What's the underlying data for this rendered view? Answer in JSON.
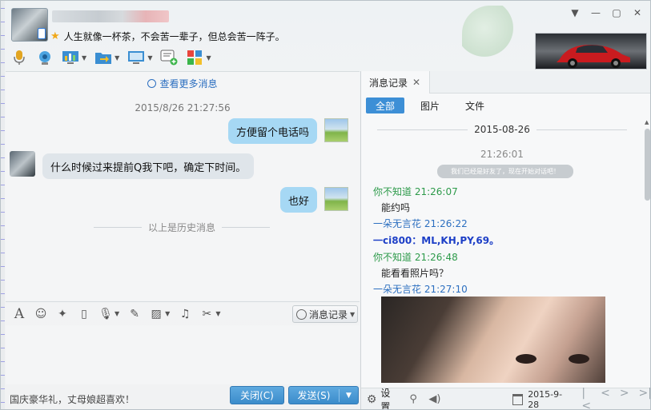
{
  "header": {
    "nickname": "█████████",
    "signature": "人生就像一杯茶，不会苦一辈子，但总会苦一阵子。",
    "window_controls": [
      "chevron-down-icon",
      "minimize-icon",
      "maximize-icon",
      "close-icon"
    ]
  },
  "toolbar": {
    "items": [
      {
        "name": "voice-call",
        "icon": "microphone-icon"
      },
      {
        "name": "video-call",
        "icon": "webcam-icon"
      },
      {
        "name": "remote-assist",
        "icon": "chart-board-icon"
      },
      {
        "name": "send-file",
        "icon": "folder-send-icon"
      },
      {
        "name": "screen-share",
        "icon": "monitor-icon"
      },
      {
        "name": "create-discussion",
        "icon": "chat-add-icon"
      },
      {
        "name": "apps",
        "icon": "apps-grid-icon"
      }
    ]
  },
  "chat": {
    "more_messages": "查看更多消息",
    "timestamp": "2015/8/26 21:27:56",
    "messages": [
      {
        "side": "right",
        "text": "方便留个电话吗"
      },
      {
        "side": "left",
        "text": "什么时候过来提前Q我下吧，确定下时间。"
      },
      {
        "side": "right",
        "text": "也好"
      }
    ],
    "history_divider": "以上是历史消息"
  },
  "input_toolbar": {
    "history_button": "消息记录"
  },
  "bottom": {
    "ad_text": "国庆豪华礼，丈母娘超喜欢！",
    "close_button": "关闭(C)",
    "send_button": "发送(S)"
  },
  "history_panel": {
    "tab_label": "消息记录",
    "filters": [
      "全部",
      "图片",
      "文件"
    ],
    "active_filter": "全部",
    "date": "2015-08-26",
    "system_time": "21:26:01",
    "system_notice": "我们已经是好友了，现在开始对话吧！",
    "records": [
      {
        "sender": "你不知道",
        "time": "21:26:07",
        "text": "能约吗",
        "color": "green"
      },
      {
        "sender": "一朵无言花",
        "time": "21:26:22",
        "text": "一ci800：ML,KH,PY,69。",
        "color": "blue"
      },
      {
        "sender": "你不知道",
        "time": "21:26:48",
        "text": "能看看照片吗？",
        "color": "green"
      },
      {
        "sender": "一朵无言花",
        "time": "21:27:10",
        "text": "",
        "color": "blue"
      }
    ],
    "settings_label": "设置",
    "date_picker": "2015-9-28"
  },
  "colors": {
    "accent": "#3d8fd6",
    "bubble_self": "#a6d8f4",
    "bubble_peer": "#dfe5ea",
    "sender_green": "#2d9a4a",
    "sender_blue": "#2c6fc0"
  }
}
